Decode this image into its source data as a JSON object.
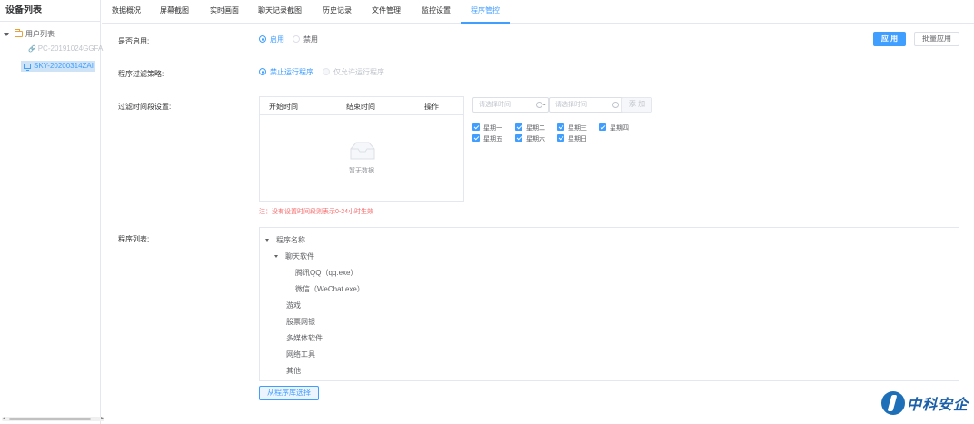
{
  "sidebar": {
    "title": "设备列表",
    "tree": {
      "root_label": "用户列表",
      "children": [
        "PC-20191024GGFA",
        "SKY-20200314ZAI"
      ]
    }
  },
  "tabs": [
    "数据概况",
    "屏幕截图",
    "实时画面",
    "聊天记录截图",
    "历史记录",
    "文件管理",
    "监控设置",
    "程序管控"
  ],
  "active_tab": "程序管控",
  "form": {
    "enabled": {
      "label": "是否启用:",
      "options": [
        "启用",
        "禁用"
      ],
      "selected": "启用"
    },
    "policy": {
      "label": "程序过滤策略:",
      "options": [
        "禁止运行程序",
        "仅允许运行程序"
      ],
      "selected": "禁止运行程序"
    },
    "time": {
      "label": "过滤时间段设置:",
      "columns": [
        "开始时间",
        "结束时间",
        "操作"
      ],
      "empty_text": "暂无数据",
      "start_placeholder": "请选择时间",
      "separator": "~",
      "end_placeholder": "请选择时间",
      "add_label": "添 加",
      "days": [
        "星期一",
        "星期二",
        "星期三",
        "星期四",
        "星期五",
        "星期六",
        "星期日"
      ],
      "note": "注：没有设置时间段则表示0-24小时生效"
    },
    "programs": {
      "label": "程序列表:",
      "root": "程序名称",
      "groups": [
        {
          "name": "聊天软件",
          "items": [
            "腾讯QQ（qq.exe）",
            "微信（WeChat.exe）"
          ]
        },
        {
          "name": "游戏"
        },
        {
          "name": "股票网银"
        },
        {
          "name": "多媒体软件"
        },
        {
          "name": "网络工具"
        },
        {
          "name": "其他"
        }
      ],
      "select_button": "从程序库选择"
    }
  },
  "actions": {
    "apply": "应 用",
    "batch_apply": "批量应用"
  },
  "logo_text": "中科安企",
  "colors": {
    "accent": "#409eff",
    "warning": "#f56c6c",
    "logo": "#1a5fa8"
  }
}
